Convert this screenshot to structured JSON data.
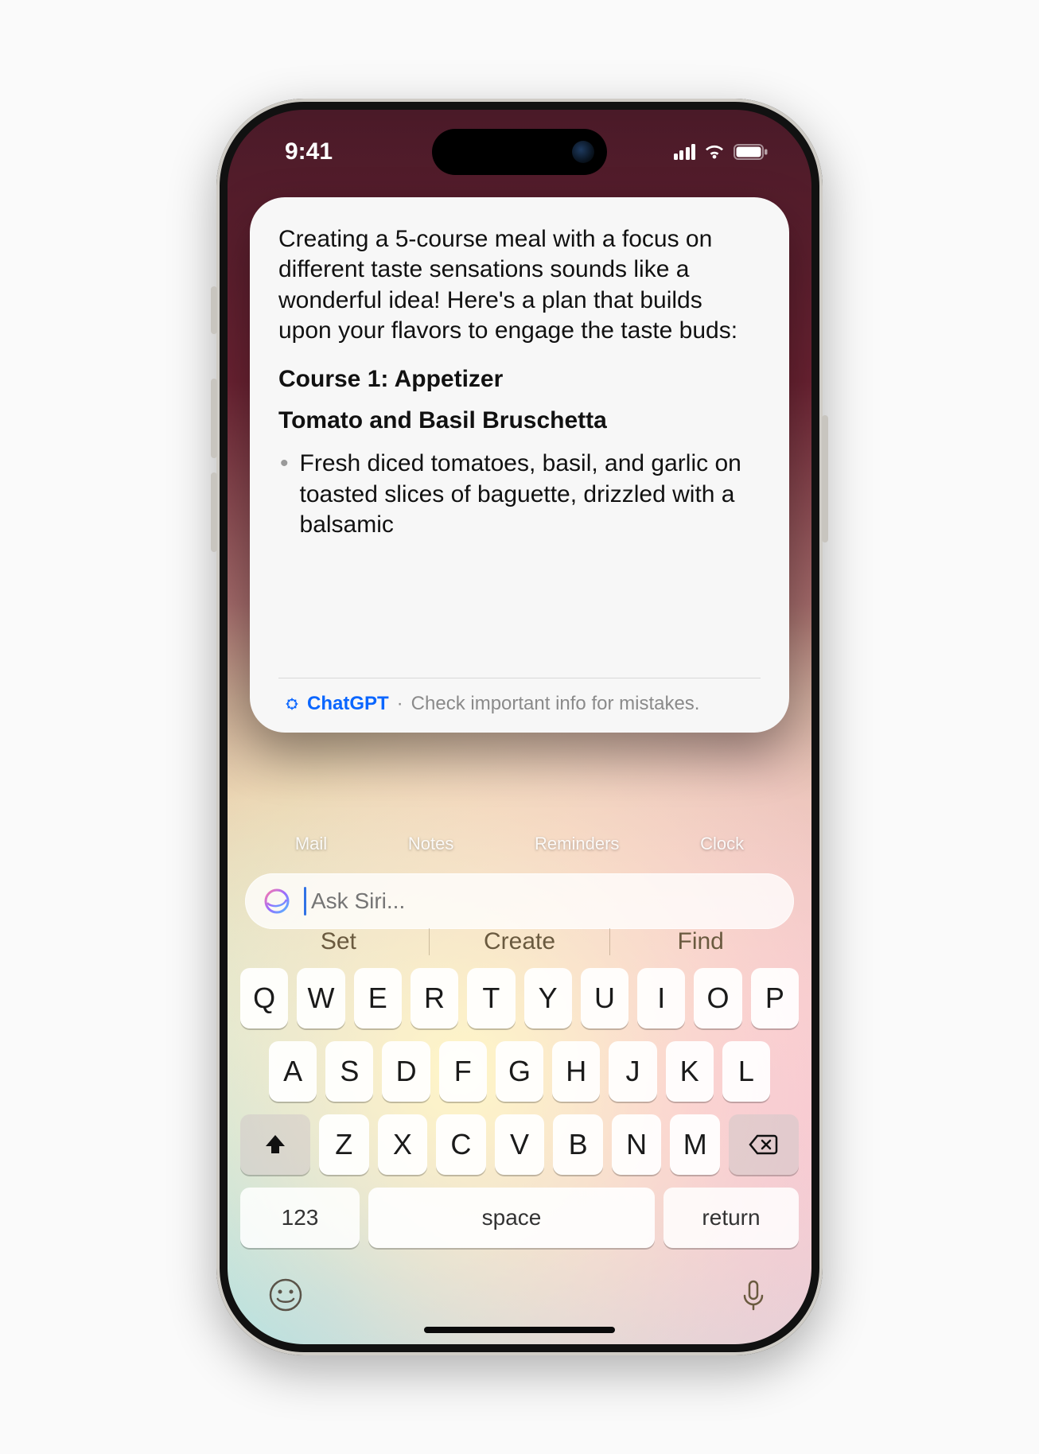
{
  "status": {
    "time": "9:41"
  },
  "response": {
    "intro": "Creating a 5-course meal with a focus on different taste sensations sounds like a wonderful idea! Here's a plan that builds upon your flavors to engage the taste buds:",
    "course_heading": "Course 1: Appetizer",
    "dish_heading": "Tomato and Basil Bruschetta",
    "bullet_1": "Fresh diced tomatoes, basil, and garlic on toasted slices of baguette, drizzled with a balsamic"
  },
  "footer": {
    "source": "ChatGPT",
    "separator": " · ",
    "disclaimer": "Check important info for mistakes."
  },
  "bg_apps": [
    "Mail",
    "Notes",
    "Reminders",
    "Clock"
  ],
  "siri": {
    "placeholder": "Ask Siri..."
  },
  "suggestions": [
    "Set",
    "Create",
    "Find"
  ],
  "keyboard": {
    "row1": [
      "Q",
      "W",
      "E",
      "R",
      "T",
      "Y",
      "U",
      "I",
      "O",
      "P"
    ],
    "row2": [
      "A",
      "S",
      "D",
      "F",
      "G",
      "H",
      "J",
      "K",
      "L"
    ],
    "row3": [
      "Z",
      "X",
      "C",
      "V",
      "B",
      "N",
      "M"
    ],
    "numbers": "123",
    "space": "space",
    "return": "return"
  }
}
